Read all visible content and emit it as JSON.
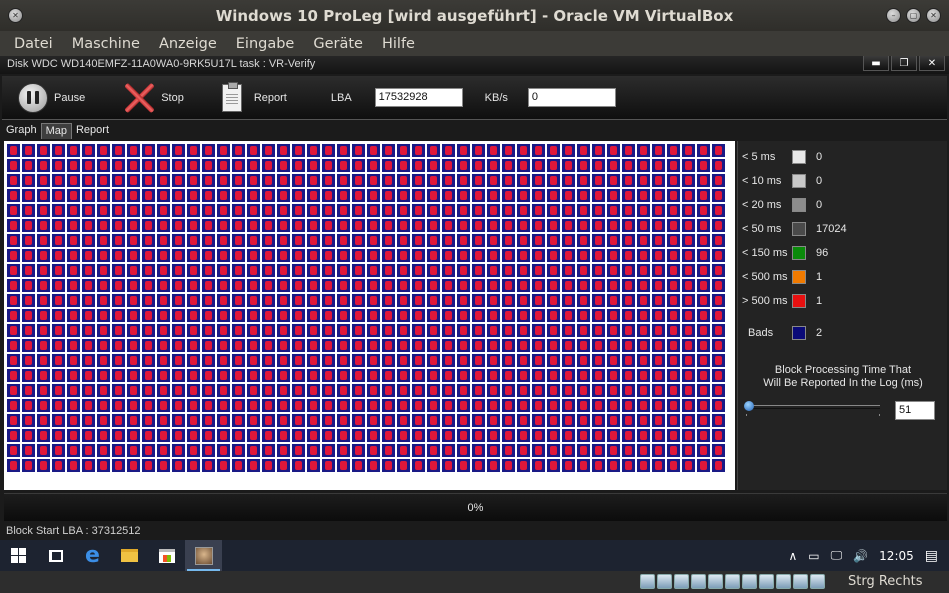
{
  "window": {
    "title": "Windows 10 ProLeg [wird ausgeführt] - Oracle VM VirtualBox"
  },
  "vbox_menu": [
    "Datei",
    "Maschine",
    "Anzeige",
    "Eingabe",
    "Geräte",
    "Hilfe"
  ],
  "app": {
    "caption": "Disk WDC WD140EMFZ-11A0WA0-9RK5U17L   task : VR-Verify",
    "toolbar": {
      "pause_label": "Pause",
      "stop_label": "Stop",
      "report_label": "Report",
      "lba_label": "LBA",
      "lba_value": "17532928",
      "kbs_label": "KB/s",
      "kbs_value": "0"
    },
    "tabs": [
      "Graph",
      "Map",
      "Report"
    ],
    "active_tab": "Map",
    "map": {
      "status": "Bads",
      "cell_count": 1056,
      "colors": {
        "bad_fill": "#1a1a86",
        "bad_mark": "#e0173a"
      }
    },
    "legend": [
      {
        "label": "< 5 ms",
        "color": "#e8e8e8",
        "value": "0"
      },
      {
        "label": "< 10 ms",
        "color": "#c8c8c8",
        "value": "0"
      },
      {
        "label": "< 20 ms",
        "color": "#8c8c8c",
        "value": "0"
      },
      {
        "label": "< 50 ms",
        "color": "#4a4a4a",
        "value": "17024"
      },
      {
        "label": "< 150 ms",
        "color": "#0a8a0a",
        "value": "96"
      },
      {
        "label": "< 500 ms",
        "color": "#f07a00",
        "value": "1"
      },
      {
        "label": "> 500 ms",
        "color": "#e81010",
        "value": "1"
      },
      {
        "label": "Bads",
        "color": "#0a0a78",
        "value": "2"
      }
    ],
    "block_note_line1": "Block Processing Time That",
    "block_note_line2": "Will Be Reported In the Log (ms)",
    "slider_value": "51",
    "progress_text": "0%",
    "block_start": "Block Start LBA : 37312512"
  },
  "taskbar": {
    "icons": [
      "windows-start-icon",
      "task-view-icon",
      "edge-icon",
      "file-explorer-icon",
      "store-icon",
      "victoria-app-icon"
    ],
    "tray": {
      "chevron": "∧",
      "time": "12:05"
    }
  },
  "vbox_status": {
    "host_key": "Strg Rechts"
  }
}
